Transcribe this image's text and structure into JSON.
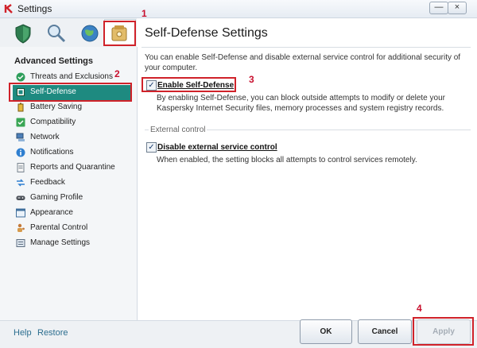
{
  "window": {
    "title": "Settings",
    "minimize": "—",
    "close": "×"
  },
  "toolbar": {
    "icons": [
      "shield-icon",
      "search-icon",
      "globe-icon",
      "safe-icon"
    ]
  },
  "sidebar": {
    "heading": "Advanced Settings",
    "items": [
      {
        "label": "Threats and Exclusions",
        "icon": "check-circle-icon"
      },
      {
        "label": "Self-Defense",
        "icon": "self-defense-icon",
        "selected": true
      },
      {
        "label": "Battery Saving",
        "icon": "battery-icon"
      },
      {
        "label": "Compatibility",
        "icon": "compatibility-icon"
      },
      {
        "label": "Network",
        "icon": "network-icon"
      },
      {
        "label": "Notifications",
        "icon": "info-icon"
      },
      {
        "label": "Reports and Quarantine",
        "icon": "report-icon"
      },
      {
        "label": "Feedback",
        "icon": "feedback-icon"
      },
      {
        "label": "Gaming Profile",
        "icon": "gamepad-icon"
      },
      {
        "label": "Appearance",
        "icon": "appearance-icon"
      },
      {
        "label": "Parental Control",
        "icon": "parental-icon"
      },
      {
        "label": "Manage Settings",
        "icon": "manage-icon"
      }
    ]
  },
  "main": {
    "title": "Self-Defense Settings",
    "description": "You can enable Self-Defense and disable external service control for additional security of your computer.",
    "self_defense": {
      "label": "Enable Self-Defense",
      "checked": true,
      "help": "By enabling Self-Defense, you can block outside attempts to modify or delete your Kaspersky Internet Security files, memory processes and system registry records."
    },
    "external_group": "External control",
    "external_control": {
      "label": "Disable external service control",
      "checked": true,
      "help": "When enabled, the setting blocks all attempts to control services remotely."
    }
  },
  "footer": {
    "help": "Help",
    "restore": "Restore",
    "ok": "OK",
    "cancel": "Cancel",
    "apply": "Apply"
  },
  "annotations": [
    "1",
    "2",
    "3",
    "4"
  ],
  "colors": {
    "selected": "#1e8a80",
    "annotation": "#d0222a",
    "link": "#2c6e8f"
  }
}
